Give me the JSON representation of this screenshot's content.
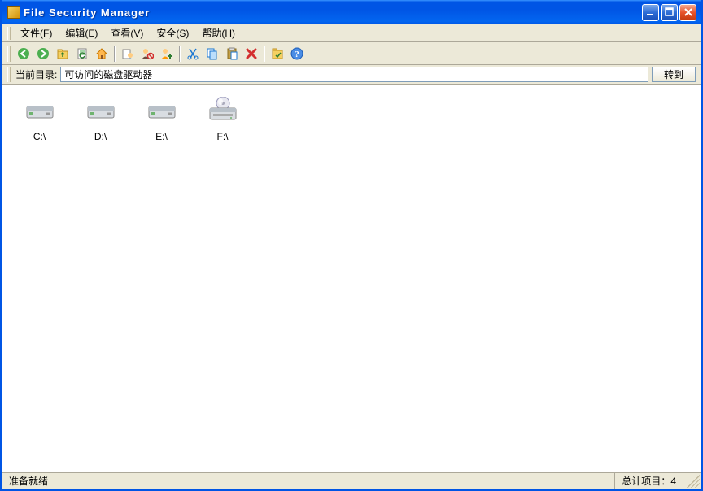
{
  "window": {
    "title": "File Security Manager"
  },
  "menu": {
    "file": "文件(F)",
    "edit": "编辑(E)",
    "view": "查看(V)",
    "security": "安全(S)",
    "help": "帮助(H)"
  },
  "toolbar_icons": {
    "back": "back-icon",
    "forward": "forward-icon",
    "up": "up-folder-icon",
    "refresh": "refresh-icon",
    "home": "home-icon",
    "user_permission": "user-permission-icon",
    "user_deny": "user-deny-icon",
    "user_add": "user-add-icon",
    "cut": "cut-icon",
    "copy": "copy-icon",
    "paste": "paste-icon",
    "delete": "delete-icon",
    "properties": "properties-icon",
    "help": "help-icon"
  },
  "address": {
    "label": "当前目录:",
    "value": "可访问的磁盘驱动器",
    "go": "转到"
  },
  "drives": [
    {
      "label": "C:\\",
      "type": "hdd"
    },
    {
      "label": "D:\\",
      "type": "hdd"
    },
    {
      "label": "E:\\",
      "type": "hdd"
    },
    {
      "label": "F:\\",
      "type": "optical"
    }
  ],
  "status": {
    "ready": "准备就绪",
    "total_label": "总计项目：",
    "total_count": 4
  }
}
